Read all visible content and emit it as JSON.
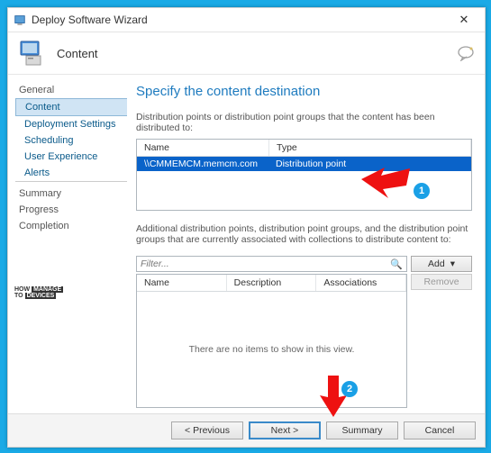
{
  "window": {
    "title": "Deploy Software Wizard",
    "close": "✕"
  },
  "header": {
    "title": "Content"
  },
  "nav": {
    "groups": [
      {
        "label": "General",
        "children": [
          "Content",
          "Deployment Settings",
          "Scheduling",
          "User Experience",
          "Alerts"
        ],
        "selected_index": 0,
        "alert_index": 4
      },
      {
        "label": "Summary",
        "children": []
      },
      {
        "label": "Progress",
        "children": []
      },
      {
        "label": "Completion",
        "children": []
      }
    ]
  },
  "main": {
    "heading": "Specify the content destination",
    "desc1": "Distribution points or distribution point groups that the content has been distributed to:",
    "list1": {
      "headers": [
        "Name",
        "Type"
      ],
      "rows": [
        {
          "name": "\\\\CMMEMCM.memcm.com",
          "type": "Distribution point"
        }
      ]
    },
    "desc2": "Additional distribution points, distribution point groups, and the distribution point groups that are currently associated with collections to distribute content to:",
    "filter_placeholder": "Filter...",
    "add_label": "Add",
    "remove_label": "Remove",
    "list2": {
      "headers": [
        "Name",
        "Description",
        "Associations"
      ],
      "empty": "There are no items to show in this view."
    }
  },
  "footer": {
    "prev": "<  Previous",
    "next": "Next  >",
    "summary": "Summary",
    "cancel": "Cancel"
  },
  "annotation": {
    "b1": "1",
    "b2": "2"
  },
  "logo": {
    "l1": "HOW",
    "l2": "MANAGE",
    "l3": "TO",
    "l4": "DEVICES"
  }
}
